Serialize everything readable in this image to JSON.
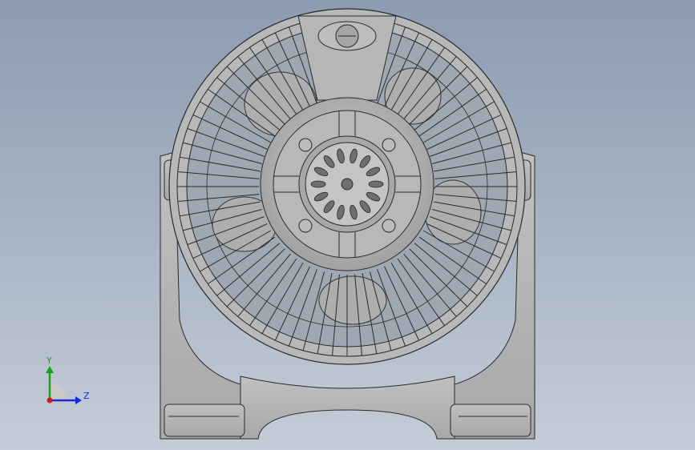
{
  "viewport": {
    "background_top": "#8c9bb0",
    "background_bottom": "#c4ccd7"
  },
  "model": {
    "part_color": "#b4b4b4",
    "edge_color": "#2a2a2a"
  },
  "triad": {
    "y_label": "Y",
    "z_label": "Z",
    "y_color": "#1aa01a",
    "z_color": "#1a2ad0",
    "x_color": "#d01a1a"
  }
}
